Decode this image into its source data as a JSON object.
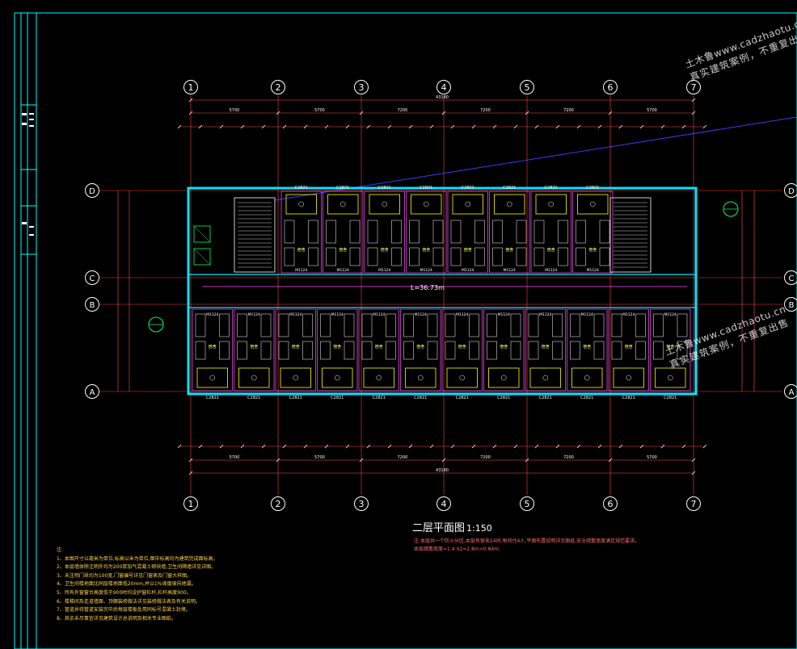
{
  "drawing": {
    "title": "二层平面图",
    "scale": "1:150",
    "corridor_length": "L=36.73m",
    "axes_numbered": [
      "1",
      "2",
      "3",
      "4",
      "5",
      "6",
      "7"
    ],
    "axes_lettered": [
      "D",
      "C",
      "B",
      "A"
    ],
    "overall_dim": "43180",
    "bays_top": [
      "5700",
      "5700",
      "7200",
      "7200",
      "7200",
      "5700",
      "5700"
    ],
    "bays_bottom": [
      "5700",
      "5700",
      "7200",
      "7200",
      "7200",
      "5700",
      "5700"
    ],
    "room_label": "宿舍",
    "window_tag": "C2821",
    "door_tag": "M1124",
    "colors": {
      "grid": "#ff3b3b",
      "wall": "#00e5ff",
      "room": "#ff4fff",
      "dim": "#ff5050",
      "axis": "#ffffff",
      "frame": "#00ffff"
    }
  },
  "title_note": [
    "注:本层共一个防火分区,本层有宿舍24间,每间住4人,平面布置说明详见图纸,安全疏散宽度满足规范要求。",
    "本层疏散宽度=1.4 X2=2.8m>0.84m"
  ],
  "notes": [
    "注:",
    "1、本图尺寸以毫米为单位,标高以米为单位,图中标高均为建筑完成面标高。",
    "2、本层墙体除注明外均为200厚加气混凝土砌块墙,卫生间隔墙详见详图。",
    "3、未注明门垛均为100宽,门窗编号详见门窗表及门窗大样图。",
    "4、卫生间楼地面比同层楼地面低20mm,并以1%坡度坡向地漏。",
    "5、所有外窗窗台高度低于900时均设护窗栏杆,栏杆高度900。",
    "6、楼梯间及走道墙面、顶棚装修做法详见装修做法表及有关说明。",
    "7、管道井待管道安装完毕后每层楼板处用同标号混凝土封堵。",
    "8、其余未尽事宜详见建筑设计总说明及相关专业图纸。"
  ],
  "watermark": {
    "line1": "土木鲁www.cadzhaotu.cn",
    "line2": "真实建筑案例，不重复出售"
  }
}
